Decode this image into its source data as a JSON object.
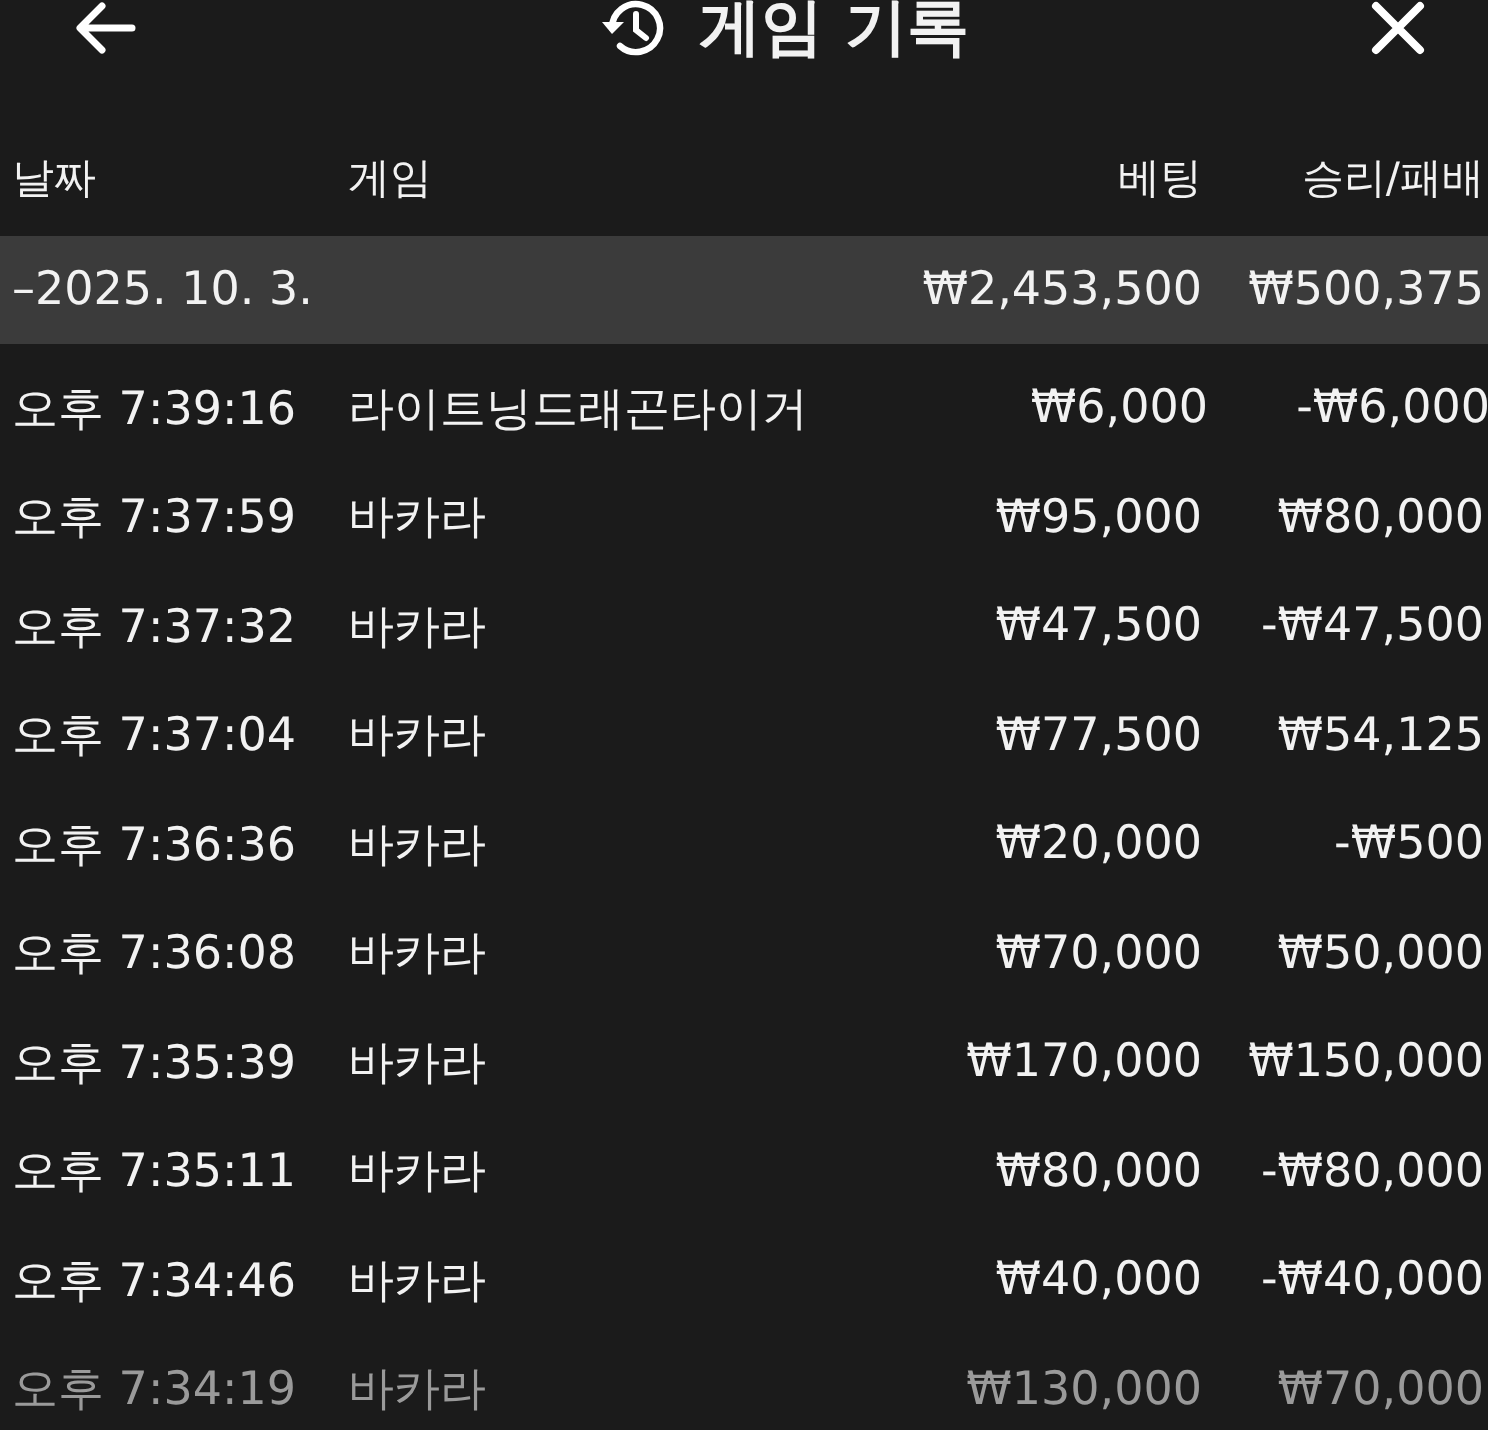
{
  "header": {
    "title": "게임 기록"
  },
  "table": {
    "columns": [
      "날짜",
      "게임",
      "베팅",
      "승리/패배"
    ],
    "group": {
      "date": "–2025. 10. 3.",
      "bet": "₩2,453,500",
      "result": "₩500,375",
      "expanded": true
    },
    "rows": [
      {
        "time": "오후 7:39:16",
        "game": "라이트닝드래곤타이거",
        "bet": "₩6,000",
        "result": "-₩6,000",
        "dimmed": false
      },
      {
        "time": "오후 7:37:59",
        "game": "바카라",
        "bet": "₩95,000",
        "result": "₩80,000",
        "dimmed": false
      },
      {
        "time": "오후 7:37:32",
        "game": "바카라",
        "bet": "₩47,500",
        "result": "-₩47,500",
        "dimmed": false
      },
      {
        "time": "오후 7:37:04",
        "game": "바카라",
        "bet": "₩77,500",
        "result": "₩54,125",
        "dimmed": false
      },
      {
        "time": "오후 7:36:36",
        "game": "바카라",
        "bet": "₩20,000",
        "result": "-₩500",
        "dimmed": false
      },
      {
        "time": "오후 7:36:08",
        "game": "바카라",
        "bet": "₩70,000",
        "result": "₩50,000",
        "dimmed": false
      },
      {
        "time": "오후 7:35:39",
        "game": "바카라",
        "bet": "₩170,000",
        "result": "₩150,000",
        "dimmed": false
      },
      {
        "time": "오후 7:35:11",
        "game": "바카라",
        "bet": "₩80,000",
        "result": "-₩80,000",
        "dimmed": false
      },
      {
        "time": "오후 7:34:46",
        "game": "바카라",
        "bet": "₩40,000",
        "result": "-₩40,000",
        "dimmed": false
      },
      {
        "time": "오후 7:34:19",
        "game": "바카라",
        "bet": "₩130,000",
        "result": "₩70,000",
        "dimmed": true
      }
    ]
  }
}
